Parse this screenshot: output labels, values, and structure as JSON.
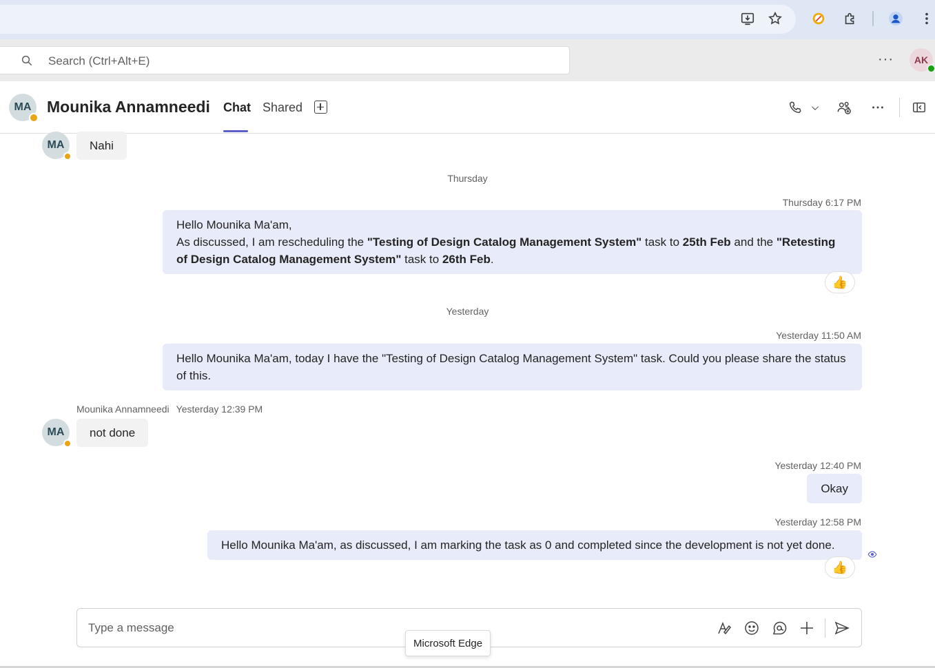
{
  "browser": {
    "icons": [
      "install-icon",
      "star-icon",
      "extension-badge-icon",
      "puzzle-icon",
      "profile-icon",
      "kebab-icon"
    ]
  },
  "teams": {
    "search_placeholder": "Search (Ctrl+Alt+E)",
    "more_label": "···",
    "user_initials": "AK"
  },
  "header": {
    "contact_initials": "MA",
    "contact_name": "Mounika Annamneedi",
    "tabs": [
      {
        "label": "Chat",
        "active": true
      },
      {
        "label": "Shared",
        "active": false
      }
    ]
  },
  "messages": {
    "first_reply": "Nahi",
    "day1": "Thursday",
    "msg1": {
      "time": "Thursday 6:17 PM",
      "line1": "Hello Mounika Ma'am,",
      "p1": "As discussed, I am rescheduling the ",
      "b1": "\"Testing of Design Catalog Management System\"",
      "p2": " task to ",
      "b2": "25th Feb",
      "p3": " and the ",
      "b3": "\"Retesting of Design Catalog Management System\"",
      "p4": " task to ",
      "b4": "26th Feb",
      "p5": ".",
      "reaction": "👍"
    },
    "day2": "Yesterday",
    "msg2": {
      "time": "Yesterday 11:50 AM",
      "text": "Hello Mounika Ma'am, today I have the \"Testing of Design Catalog Management System\" task. Could you please share the status of this."
    },
    "msg3": {
      "sender": "Mounika Annamneedi",
      "time": "Yesterday 12:39 PM",
      "text": "not done"
    },
    "msg4": {
      "time": "Yesterday 12:40 PM",
      "text": "Okay"
    },
    "msg5": {
      "time": "Yesterday 12:58 PM",
      "text": "Hello Mounika Ma'am, as discussed, I am marking the task as 0 and completed since the development is not yet done.",
      "reaction": "👍"
    }
  },
  "compose": {
    "placeholder": "Type a message"
  },
  "tooltip": "Microsoft Edge",
  "colors": {
    "accent": "#5b5fc7",
    "outgoing_bubble": "#e8ebfa",
    "incoming_bubble": "#f2f2f2",
    "away_status": "#e9a515"
  }
}
